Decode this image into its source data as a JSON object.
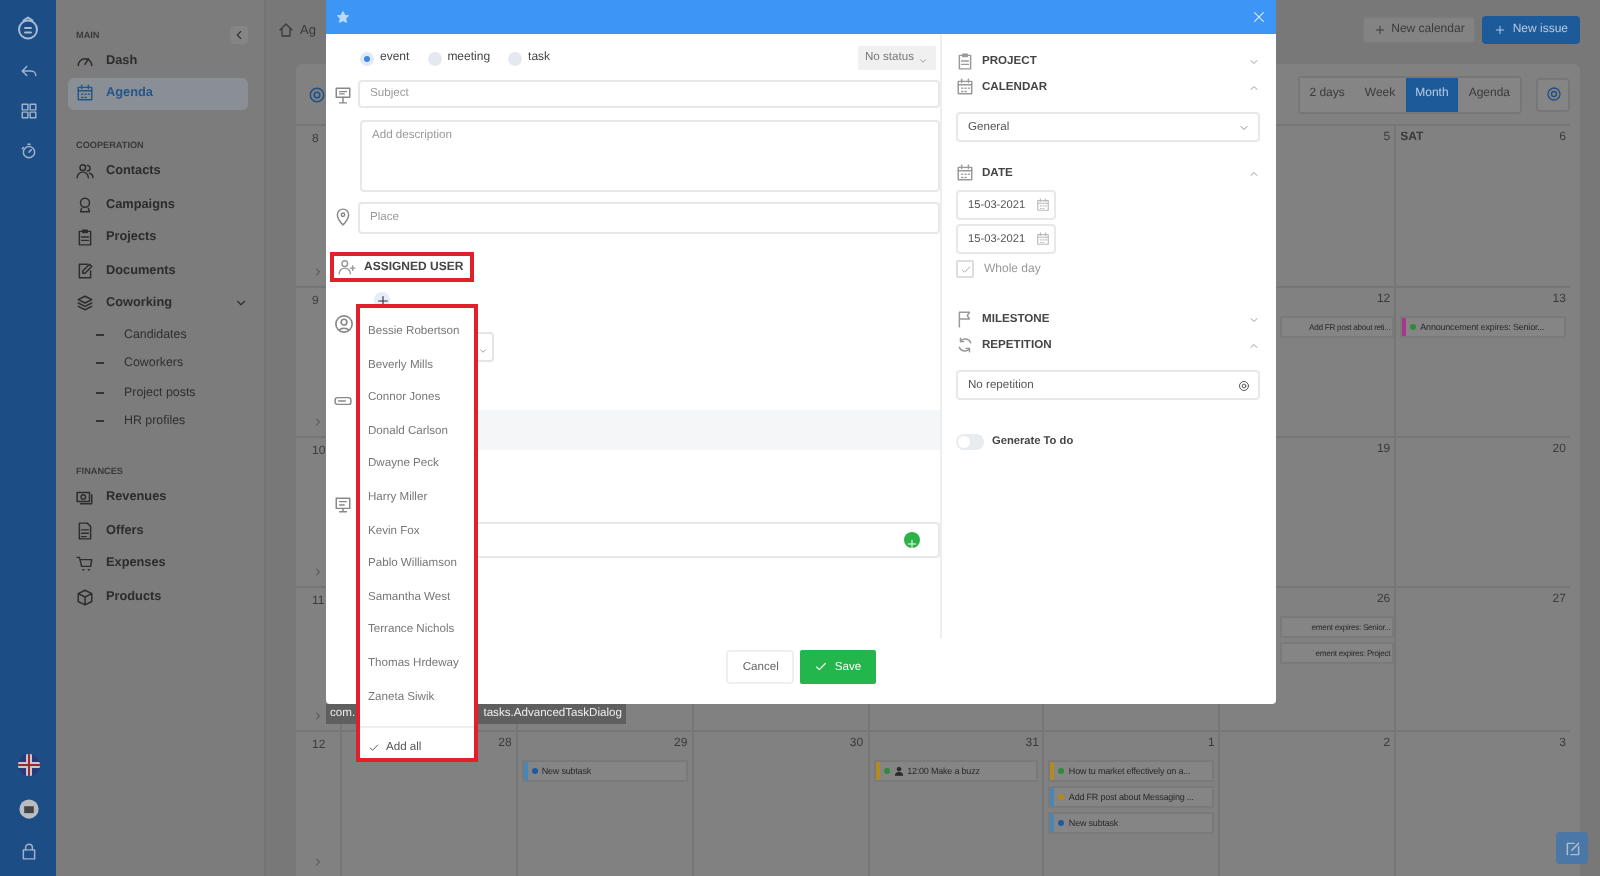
{
  "sidebar": {
    "sections": [
      {
        "title": "MAIN",
        "items": [
          {
            "label": "Dash",
            "selected": false
          },
          {
            "label": "Agenda",
            "selected": true
          }
        ]
      },
      {
        "title": "COOPERATION",
        "items": [
          {
            "label": "Contacts",
            "selected": false
          },
          {
            "label": "Campaigns",
            "selected": false
          },
          {
            "label": "Projects",
            "selected": false
          },
          {
            "label": "Documents",
            "selected": false
          },
          {
            "label": "Coworking",
            "selected": false,
            "expanded": true,
            "children": [
              {
                "label": "Candidates",
                "selected": false
              },
              {
                "label": "Coworkers",
                "selected": false
              },
              {
                "label": "Project posts",
                "selected": false
              },
              {
                "label": "HR profiles",
                "selected": false
              }
            ]
          }
        ]
      },
      {
        "title": "FINANCES",
        "items": [
          {
            "label": "Revenues",
            "selected": false
          },
          {
            "label": "Offers",
            "selected": false
          },
          {
            "label": "Expenses",
            "selected": false
          },
          {
            "label": "Products",
            "selected": false
          }
        ]
      }
    ]
  },
  "topbar": {
    "breadcrumb": "Ag",
    "buttons": [
      {
        "label": "New calendar",
        "kind": "outline"
      },
      {
        "label": "New issue",
        "kind": "primary"
      }
    ]
  },
  "calendar": {
    "views": [
      {
        "label": "2 days",
        "selected": false
      },
      {
        "label": "Week",
        "selected": false
      },
      {
        "label": "Month",
        "selected": true
      },
      {
        "label": "Agenda",
        "selected": false
      }
    ],
    "weeks": [
      {
        "number": "8",
        "days": [
          {
            "date": "5"
          },
          {
            "day_name": "SAT",
            "date": "6"
          }
        ]
      },
      {
        "number": "9",
        "days": [
          {
            "date": "12",
            "events": [
              {
                "title": "Add FR post about reti...",
                "kind": "partial"
              }
            ]
          },
          {
            "date": "13",
            "events": [
              {
                "title": "Announcement expires: Senior...",
                "kind": "announcement",
                "color": "#2f8a3a"
              }
            ]
          }
        ]
      },
      {
        "number": "10",
        "days": [
          {
            "date": "19"
          },
          {
            "date": "20"
          }
        ]
      },
      {
        "number": "11",
        "days": [
          {
            "date": "26",
            "events": [
              {
                "title": "ement expires: Senior...",
                "kind": "partial"
              },
              {
                "title": "ement expires: Project",
                "kind": "partial"
              }
            ]
          },
          {
            "date": "27"
          }
        ]
      },
      {
        "number": "12",
        "days": [
          {
            "date": "28"
          },
          {
            "date": "29",
            "events": [
              {
                "title": "New subtask",
                "kind": "subtask",
                "color": "#1f5aa0"
              }
            ]
          },
          {
            "date": "30"
          },
          {
            "date": "31",
            "events": [
              {
                "title": "12:00 Make a buzz",
                "kind": "meeting",
                "color": "#2f8a3a"
              }
            ]
          },
          {
            "date": "1",
            "events": [
              {
                "title": "How tu market effectively on a...",
                "kind": "campaign",
                "color": "#2f8a3a"
              },
              {
                "title": "Add FR post about Messaging ...",
                "kind": "subtask",
                "color": "#b08a22"
              },
              {
                "title": "New subtask",
                "kind": "subtask",
                "color": "#1f5aa0"
              }
            ]
          },
          {
            "date": "2"
          },
          {
            "date": "3"
          }
        ]
      }
    ]
  },
  "modal": {
    "type_options": [
      {
        "label": "event",
        "selected": true
      },
      {
        "label": "meeting",
        "selected": false
      },
      {
        "label": "task",
        "selected": false
      }
    ],
    "status": "No status",
    "subject": {
      "placeholder": "Subject"
    },
    "description": {
      "placeholder": "Add description"
    },
    "place": {
      "placeholder": "Place"
    },
    "assigned_user": {
      "title": "ASSIGNED USER",
      "options": [
        {
          "label": "Bessie Robertson"
        },
        {
          "label": "Beverly Mills"
        },
        {
          "label": "Connor Jones"
        },
        {
          "label": "Donald Carlson"
        },
        {
          "label": "Dwayne Peck"
        },
        {
          "label": "Harry Miller"
        },
        {
          "label": "Kevin Fox"
        },
        {
          "label": "Pablo Williamson"
        },
        {
          "label": "Samantha West"
        },
        {
          "label": "Terrance Nichols"
        },
        {
          "label": "Thomas Hrdeway"
        },
        {
          "label": "Zaneta Siwik"
        }
      ],
      "add_all": "Add all"
    },
    "side": {
      "sections": [
        {
          "title": "PROJECT",
          "expanded": false
        },
        {
          "title": "CALENDAR",
          "expanded": true,
          "kind": "select",
          "value": "General"
        },
        {
          "title": "DATE",
          "expanded": true,
          "kind": "date",
          "dates": [
            "15-03-2021",
            "15-03-2021"
          ],
          "whole_day": {
            "label": "Whole day",
            "checked": true
          }
        },
        {
          "title": "MILESTONE",
          "expanded": false
        },
        {
          "title": "REPETITION",
          "expanded": true,
          "kind": "repeat",
          "value": "No repetition"
        }
      ],
      "generate_todo": {
        "label": "Generate To do",
        "on": false
      }
    },
    "footer": {
      "cancel": "Cancel",
      "save": "Save"
    }
  },
  "tooltip": {
    "parts": [
      "com.",
      "tasks.AdvancedTaskDialog"
    ]
  }
}
